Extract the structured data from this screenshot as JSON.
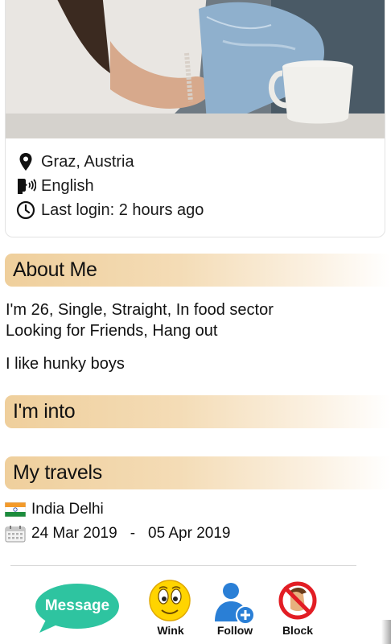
{
  "profile": {
    "location": "Graz, Austria",
    "language": "English",
    "last_login": "Last login: 2 hours ago"
  },
  "about": {
    "title": "About Me",
    "line1": "I'm 26, Single, Straight, In food sector",
    "line2": "Looking for Friends, Hang out",
    "bio": "I like hunky boys"
  },
  "interests": {
    "title": "I'm into"
  },
  "travels": {
    "title": "My travels",
    "items": [
      {
        "destination": "India Delhi",
        "from": "24 Mar 2019",
        "separator": "-",
        "to": "05 Apr 2019"
      }
    ]
  },
  "actions": {
    "message": "Message",
    "wink": "Wink",
    "follow": "Follow",
    "block": "Block"
  },
  "icons": {
    "location": "location-pin-icon",
    "language": "speaking-head-icon",
    "last_login": "clock-icon",
    "flag": "india-flag-icon",
    "calendar": "calendar-icon"
  },
  "colors": {
    "header_gradient_start": "#efcf9c",
    "message_green": "#2ec4a0",
    "follow_blue": "#2a7fd6",
    "block_red": "#e21d24"
  }
}
